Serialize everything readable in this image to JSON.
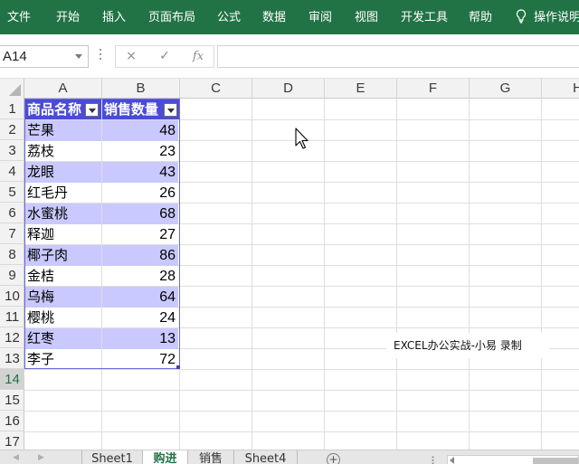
{
  "ribbon": {
    "bg_color": "#217346",
    "tabs": [
      "文件",
      "开始",
      "插入",
      "页面布局",
      "公式",
      "数据",
      "审阅",
      "视图",
      "开发工具",
      "帮助"
    ],
    "tell_me": "操作说明搜索"
  },
  "formula_bar": {
    "name_box": "A14",
    "cancel_glyph": "×",
    "enter_glyph": "✓",
    "fx_label": "fx",
    "formula": ""
  },
  "grid": {
    "columns": [
      "A",
      "B",
      "C",
      "D",
      "E",
      "F",
      "G",
      "H"
    ],
    "rows": [
      "1",
      "2",
      "3",
      "4",
      "5",
      "6",
      "7",
      "8",
      "9",
      "10",
      "11",
      "12",
      "13",
      "14",
      "15",
      "16",
      "17"
    ],
    "selected_row": "14",
    "band_color": "#c9c9ff",
    "header_color": "#4b4bd8"
  },
  "table": {
    "headers": [
      "商品名称",
      "销售数量"
    ],
    "rows": [
      {
        "name": "芒果",
        "qty": "48"
      },
      {
        "name": "荔枝",
        "qty": "23"
      },
      {
        "name": "龙眼",
        "qty": "43"
      },
      {
        "name": "红毛丹",
        "qty": "26"
      },
      {
        "name": "水蜜桃",
        "qty": "68"
      },
      {
        "name": "释迦",
        "qty": "27"
      },
      {
        "name": "椰子肉",
        "qty": "86"
      },
      {
        "name": "金桔",
        "qty": "28"
      },
      {
        "name": "乌梅",
        "qty": "64"
      },
      {
        "name": "樱桃",
        "qty": "24"
      },
      {
        "name": "红枣",
        "qty": "13"
      },
      {
        "name": "李子",
        "qty": "72"
      }
    ]
  },
  "watermark": "EXCEL办公实战-小易 录制",
  "sheet_tabs": [
    {
      "label": "Sheet1",
      "active": false
    },
    {
      "label": "购进",
      "active": true
    },
    {
      "label": "销售",
      "active": false
    },
    {
      "label": "Sheet4",
      "active": false
    }
  ],
  "add_sheet_glyph": "+",
  "icons": [
    "lightbulb-icon",
    "cancel-icon",
    "enter-icon",
    "fx-icon",
    "filter-dropdown-icon",
    "mouse-cursor-icon",
    "add-sheet-icon"
  ]
}
